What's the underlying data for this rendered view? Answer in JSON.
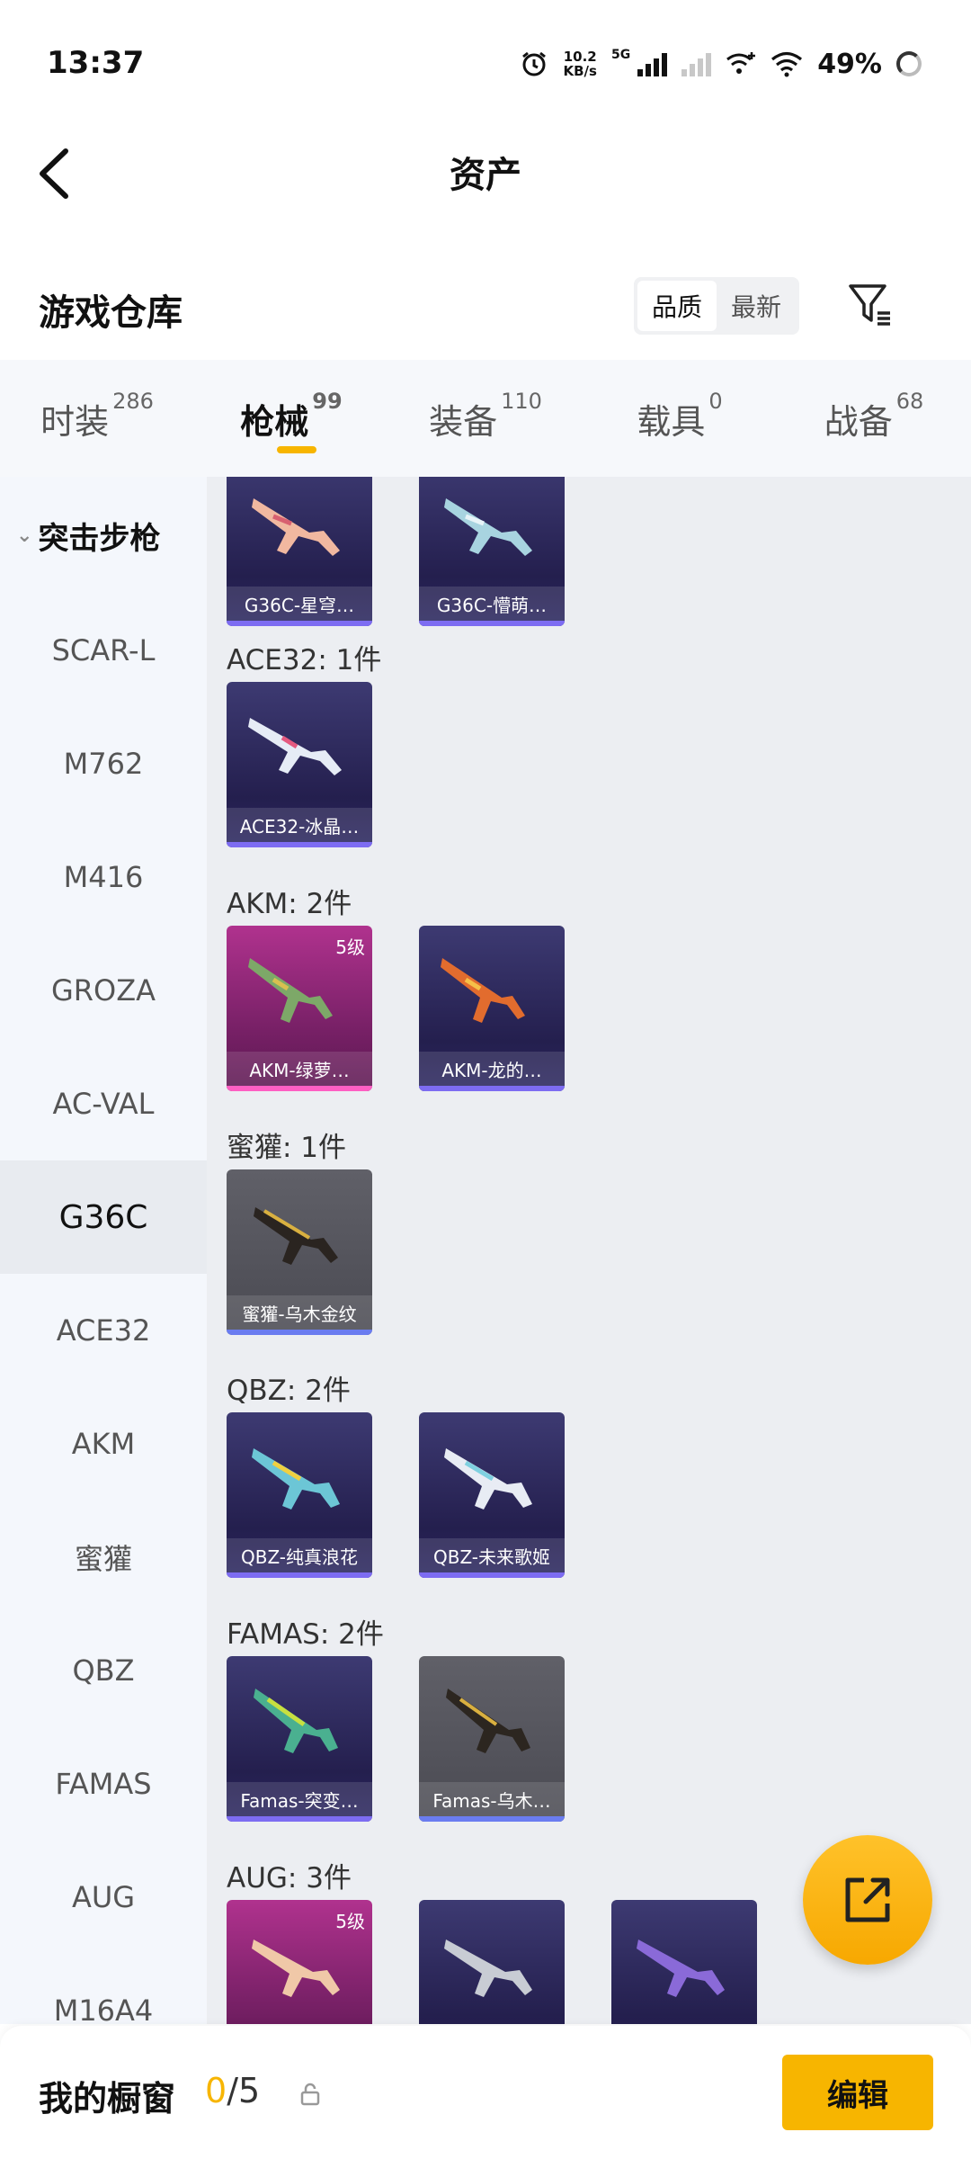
{
  "status_bar": {
    "time": "13:37",
    "speed_value": "10.2",
    "speed_unit": "KB/s",
    "network": "5G",
    "battery": "49%"
  },
  "header": {
    "title": "资产",
    "back_icon": "chevron-left-icon"
  },
  "warehouse": {
    "title": "游戏仓库",
    "sort_options": [
      "品质",
      "最新"
    ],
    "sort_selected": "品质",
    "filter_icon": "filter-icon"
  },
  "tabs": [
    {
      "label": "时装",
      "count": "286",
      "active": false
    },
    {
      "label": "枪械",
      "count": "99",
      "active": true
    },
    {
      "label": "装备",
      "count": "110",
      "active": false
    },
    {
      "label": "载具",
      "count": "0",
      "active": false
    },
    {
      "label": "战备",
      "count": "68",
      "active": false
    }
  ],
  "sidebar": {
    "group": "突击步枪",
    "items": [
      "SCAR-L",
      "M762",
      "M416",
      "GROZA",
      "AC-VAL",
      "G36C",
      "ACE32",
      "AKM",
      "蜜獾",
      "QBZ",
      "FAMAS",
      "AUG",
      "M16A4"
    ],
    "active": "G36C"
  },
  "groups": [
    {
      "label": "",
      "items": [
        {
          "name": "G36C-星穹…",
          "rarity": "purple",
          "level": ""
        },
        {
          "name": "G36C-懵萌…",
          "rarity": "purple",
          "level": ""
        }
      ]
    },
    {
      "label": "ACE32: 1件",
      "items": [
        {
          "name": "ACE32-冰晶…",
          "rarity": "purple",
          "level": ""
        }
      ]
    },
    {
      "label": "AKM: 2件",
      "items": [
        {
          "name": "AKM-绿萝…",
          "rarity": "pink",
          "level": "5级"
        },
        {
          "name": "AKM-龙的…",
          "rarity": "purple",
          "level": ""
        }
      ]
    },
    {
      "label": "蜜獾: 1件",
      "items": [
        {
          "name": "蜜獾-乌木金纹",
          "rarity": "gray",
          "level": ""
        }
      ]
    },
    {
      "label": "QBZ: 2件",
      "items": [
        {
          "name": "QBZ-纯真浪花",
          "rarity": "purple",
          "level": ""
        },
        {
          "name": "QBZ-未来歌姬",
          "rarity": "purple",
          "level": ""
        }
      ]
    },
    {
      "label": "FAMAS: 2件",
      "items": [
        {
          "name": "Famas-突变…",
          "rarity": "purple",
          "level": ""
        },
        {
          "name": "Famas-乌木…",
          "rarity": "gray",
          "level": ""
        }
      ]
    },
    {
      "label": "AUG: 3件",
      "items": [
        {
          "name": "",
          "rarity": "pink",
          "level": "5级"
        },
        {
          "name": "",
          "rarity": "purple",
          "level": ""
        },
        {
          "name": "",
          "rarity": "purple",
          "level": ""
        }
      ]
    }
  ],
  "showcase": {
    "title": "我的橱窗",
    "current": "0",
    "separator": "/",
    "max": "5",
    "edit_label": "编辑"
  },
  "colors": {
    "accent": "#f7b500",
    "purple_card": "#2b2760",
    "pink_card": "#7a2168"
  },
  "fab_icon": "share-export-icon"
}
